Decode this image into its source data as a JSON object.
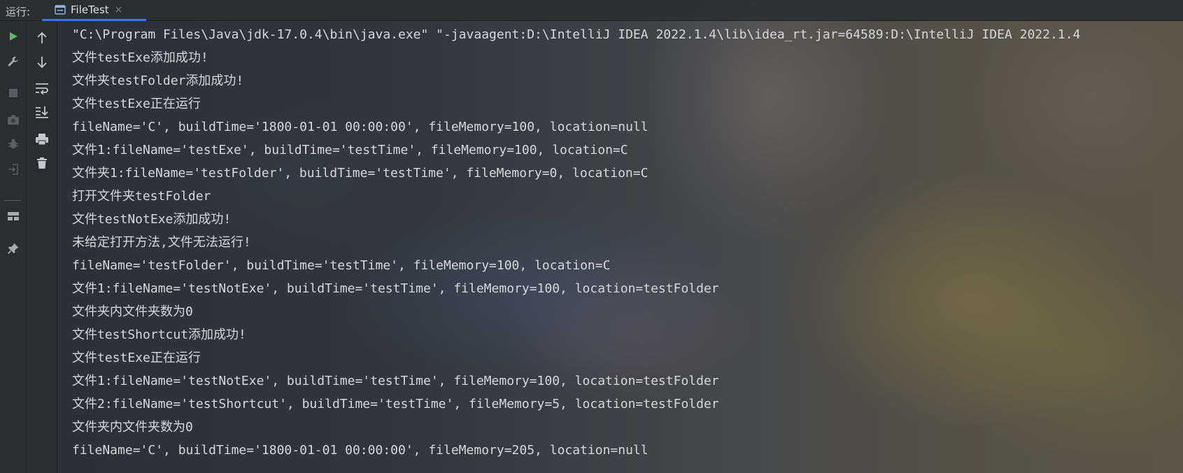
{
  "header": {
    "run_label": "运行:",
    "tab": {
      "icon": "console-window-icon",
      "label": "FileTest",
      "close_glyph": "×"
    }
  },
  "toolbar": {
    "primary": [
      {
        "name": "run-icon",
        "enabled": true
      },
      {
        "name": "wrench-icon",
        "enabled": true
      },
      {
        "name": "stop-icon",
        "enabled": false
      },
      {
        "name": "camera-icon",
        "enabled": false
      },
      {
        "name": "debug-bug-icon",
        "enabled": false
      },
      {
        "name": "exit-icon",
        "enabled": false
      },
      {
        "name": "layout-icon",
        "enabled": true
      },
      {
        "name": "pin-icon",
        "enabled": true
      }
    ],
    "secondary": [
      {
        "name": "arrow-up-icon"
      },
      {
        "name": "arrow-down-icon"
      },
      {
        "name": "soft-wrap-icon"
      },
      {
        "name": "scroll-to-end-icon"
      },
      {
        "name": "print-icon"
      },
      {
        "name": "trash-icon"
      }
    ]
  },
  "console": {
    "lines": [
      "\"C:\\Program Files\\Java\\jdk-17.0.4\\bin\\java.exe\" \"-javaagent:D:\\IntelliJ IDEA 2022.1.4\\lib\\idea_rt.jar=64589:D:\\IntelliJ IDEA 2022.1.4",
      "文件testExe添加成功!",
      "文件夹testFolder添加成功!",
      "文件testExe正在运行",
      "fileName='C', buildTime='1800-01-01 00:00:00', fileMemory=100, location=null",
      "文件1:fileName='testExe', buildTime='testTime', fileMemory=100, location=C",
      "文件夹1:fileName='testFolder', buildTime='testTime', fileMemory=0, location=C",
      "打开文件夹testFolder",
      "文件testNotExe添加成功!",
      "未给定打开方法,文件无法运行!",
      "fileName='testFolder', buildTime='testTime', fileMemory=100, location=C",
      "文件1:fileName='testNotExe', buildTime='testTime', fileMemory=100, location=testFolder",
      "文件夹内文件夹数为0",
      "文件testShortcut添加成功!",
      "文件testExe正在运行",
      "文件1:fileName='testNotExe', buildTime='testTime', fileMemory=100, location=testFolder",
      "文件2:fileName='testShortcut', buildTime='testTime', fileMemory=5, location=testFolder",
      "文件夹内文件夹数为0",
      "fileName='C', buildTime='1800-01-01 00:00:00', fileMemory=205, location=null"
    ]
  },
  "colors": {
    "accent": "#3574f0",
    "run_green": "#5fb865",
    "icon_gray": "#a8abb0",
    "disabled_gray": "#5a5d62"
  }
}
